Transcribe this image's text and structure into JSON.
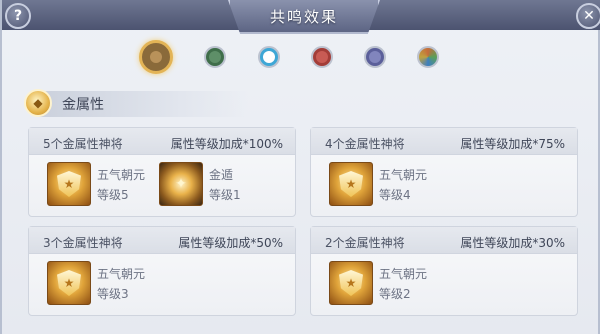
{
  "window": {
    "title": "共鸣效果",
    "help_symbol": "?",
    "close_symbol": "✕"
  },
  "elements": [
    {
      "icon": "gold-element-icon",
      "color": "#8a6a3a",
      "selected": true
    },
    {
      "icon": "wood-element-icon",
      "color": "#3f6e4a",
      "selected": false
    },
    {
      "icon": "water-element-icon",
      "color": "#3ea7d6",
      "selected": false
    },
    {
      "icon": "fire-element-icon",
      "color": "#a33d38",
      "selected": false
    },
    {
      "icon": "earth-element-icon",
      "color": "#5b5f9a",
      "selected": false
    },
    {
      "icon": "multi-element-icon",
      "color": "#c66b3a",
      "selected": false
    }
  ],
  "section": {
    "label": "金属性"
  },
  "cards": [
    {
      "title": "5个金属性神将",
      "bonus": "属性等级加成*100%",
      "heroes": [
        {
          "name": "五气朝元",
          "level": "等级5",
          "icon": "shield-emblem-icon"
        },
        {
          "name": "金遁",
          "level": "等级1",
          "icon": "golden-swirl-icon"
        }
      ]
    },
    {
      "title": "4个金属性神将",
      "bonus": "属性等级加成*75%",
      "heroes": [
        {
          "name": "五气朝元",
          "level": "等级4",
          "icon": "shield-emblem-icon"
        }
      ]
    },
    {
      "title": "3个金属性神将",
      "bonus": "属性等级加成*50%",
      "heroes": [
        {
          "name": "五气朝元",
          "level": "等级3",
          "icon": "shield-emblem-icon"
        }
      ]
    },
    {
      "title": "2个金属性神将",
      "bonus": "属性等级加成*30%",
      "heroes": [
        {
          "name": "五气朝元",
          "level": "等级2",
          "icon": "shield-emblem-icon"
        }
      ]
    }
  ]
}
